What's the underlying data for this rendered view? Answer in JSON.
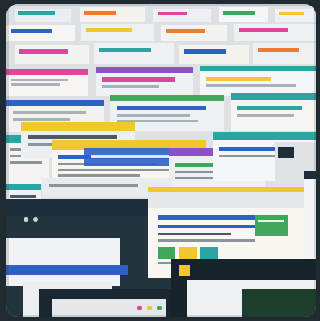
{
  "image": {
    "alt": "",
    "subject": "stacked-browser-windows",
    "palette": {
      "frame": "#1f2a31",
      "backdrop": "#dfe3e6",
      "window_blue": "#2d62c4",
      "window_dark": "#1d2e3a",
      "accent_yellow": "#f2c62f",
      "accent_pink": "#e0479b",
      "accent_green": "#3fa85b",
      "accent_teal": "#2aa5a1",
      "accent_orange": "#f07b2c",
      "accent_purple": "#8a52c8",
      "paper": "#f7f6f1"
    },
    "icons": [
      "window-dots-icon",
      "address-bar-icon",
      "tab-icon"
    ]
  }
}
